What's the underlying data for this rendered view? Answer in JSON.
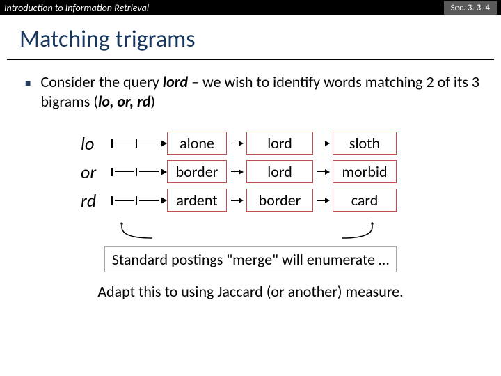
{
  "header": {
    "left": "Introduction to Information Retrieval",
    "right": "Sec. 3. 3. 4"
  },
  "title": "Matching trigrams",
  "bullet": {
    "pre": "Consider the query ",
    "query": "lord",
    "mid": " – we wish to identify words matching 2 of its 3 bigrams (",
    "bigrams": "lo, or, rd",
    "post": ")"
  },
  "rows": [
    {
      "bigram": "lo",
      "cells": [
        "alone",
        "lord",
        "sloth"
      ]
    },
    {
      "bigram": "or",
      "cells": [
        "border",
        "lord",
        "morbid"
      ]
    },
    {
      "bigram": "rd",
      "cells": [
        "ardent",
        "border",
        "card"
      ]
    }
  ],
  "mergebox": "Standard postings \"merge\" will enumerate …",
  "adapt": "Adapt this to using Jaccard (or another) measure."
}
